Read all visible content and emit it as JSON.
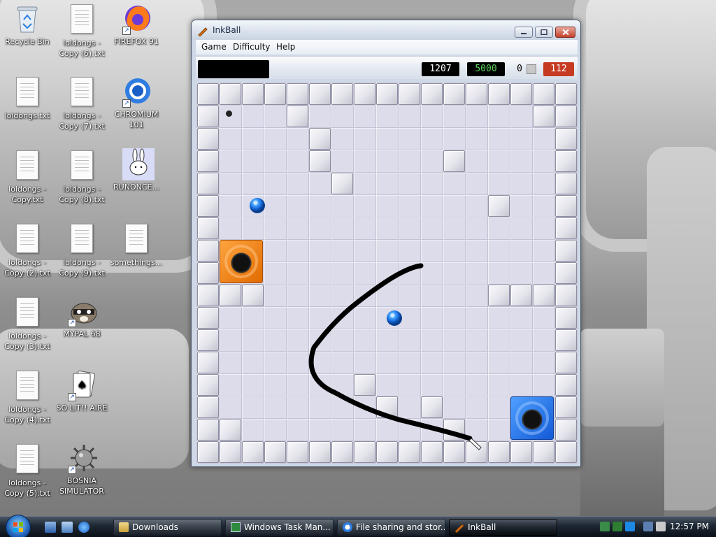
{
  "desktop": {
    "icons": [
      {
        "label": "Recycle Bin"
      },
      {
        "label": "loldongs - Copy (6).txt"
      },
      {
        "label": "FIREFOX 91"
      },
      {
        "label": "loldongs.txt"
      },
      {
        "label": "loldongs - Copy (7).txt"
      },
      {
        "label": "CHROMIUM 101"
      },
      {
        "label": "loldongs - Copy.txt"
      },
      {
        "label": "loldongs - Copy (8).txt"
      },
      {
        "label": "RUNONCE..."
      },
      {
        "label": "loldongs - Copy (2).txt"
      },
      {
        "label": "loldongs - Copy (9).txt"
      },
      {
        "label": "somethings..."
      },
      {
        "label": "loldongs - Copy (3).txt"
      },
      {
        "label": "MYPAL 68"
      },
      {
        "label": "loldongs - Copy (4).txt"
      },
      {
        "label": "SO LIT!! AIRE"
      },
      {
        "label": "loldongs - Copy (5).txt"
      },
      {
        "label": "BOSNIA SIMULATOR"
      }
    ]
  },
  "window": {
    "title": "InkBall",
    "menu": [
      "Game",
      "Difficulty",
      "Help"
    ]
  },
  "scoreboard": {
    "score": "1207",
    "target": "5000",
    "balls": "0",
    "timer": "112"
  },
  "board": {
    "colors": {
      "orange": "#f07c10",
      "blue": "#1f6fe8",
      "ink": "#000000"
    }
  },
  "taskbar": {
    "buttons": [
      {
        "label": "Downloads"
      },
      {
        "label": "Windows Task Man..."
      },
      {
        "label": "File sharing and stor..."
      },
      {
        "label": "InkBall"
      }
    ],
    "clock": "12:57 PM"
  }
}
